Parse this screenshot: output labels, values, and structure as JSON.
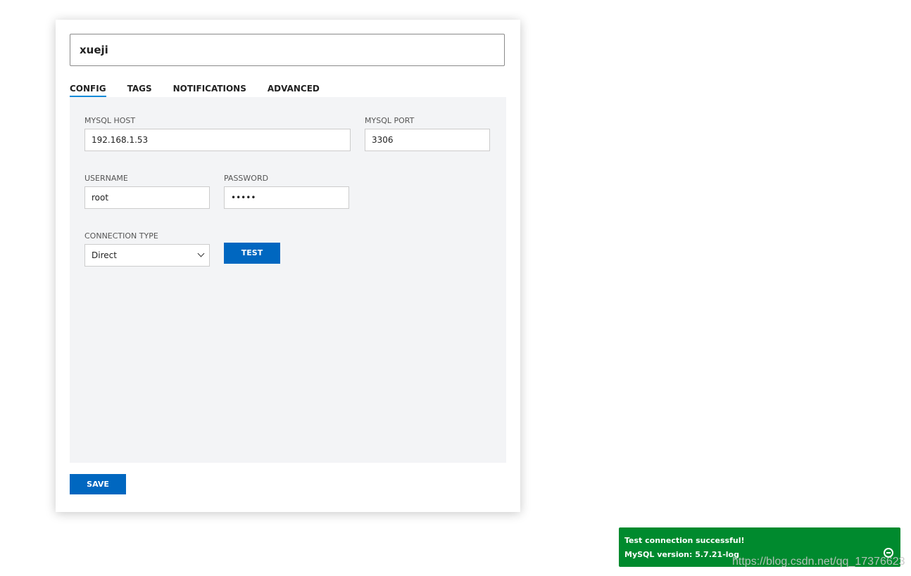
{
  "resource": {
    "name": "xueji"
  },
  "tabs": [
    {
      "label": "CONFIG",
      "active": true
    },
    {
      "label": "TAGS",
      "active": false
    },
    {
      "label": "NOTIFICATIONS",
      "active": false
    },
    {
      "label": "ADVANCED",
      "active": false
    }
  ],
  "form": {
    "host": {
      "label": "MYSQL HOST",
      "value": "192.168.1.53"
    },
    "port": {
      "label": "MYSQL PORT",
      "value": "3306"
    },
    "username": {
      "label": "USERNAME",
      "value": "root"
    },
    "password": {
      "label": "PASSWORD",
      "value": "•••••"
    },
    "connection_type": {
      "label": "CONNECTION TYPE",
      "value": "Direct"
    },
    "test_label": "TEST"
  },
  "save_label": "SAVE",
  "toast": {
    "line1": "Test connection successful!",
    "line2": "MySQL version: 5.7.21-log",
    "color": "#008a2e"
  },
  "watermark": "https://blog.csdn.net/qq_17376623",
  "colors": {
    "accent": "#0067c0",
    "tab_indicator": "#0a8ad8"
  }
}
